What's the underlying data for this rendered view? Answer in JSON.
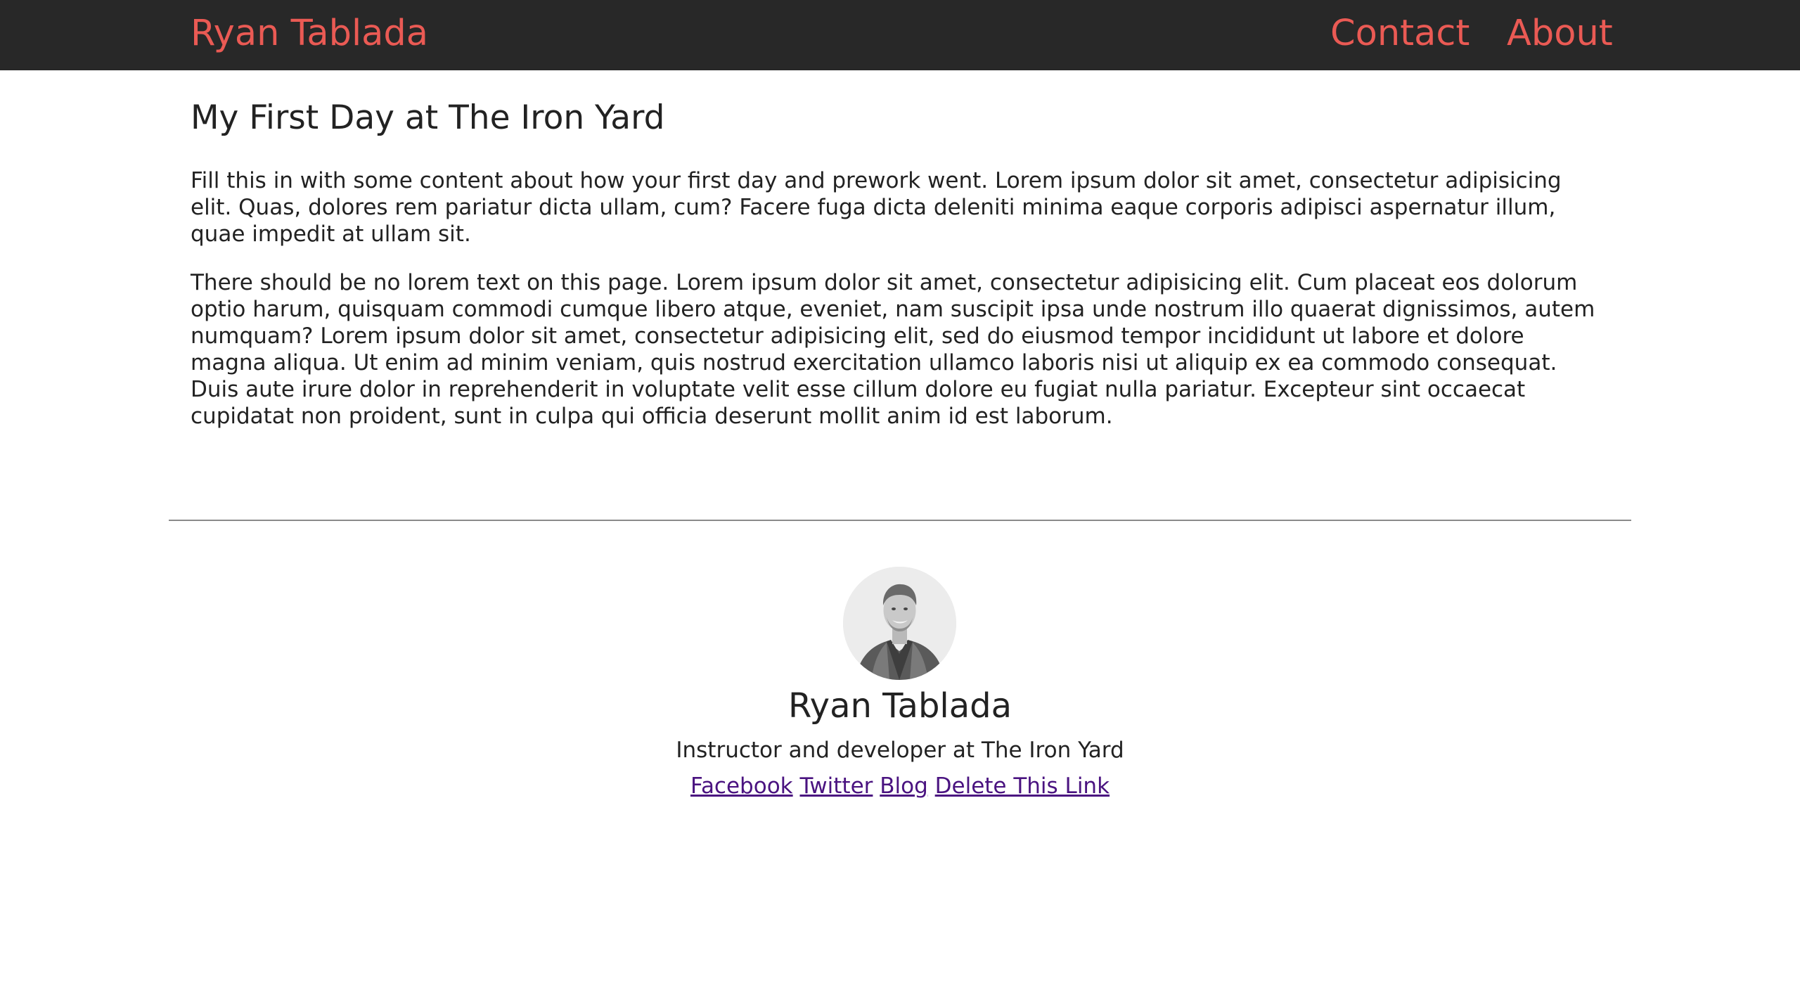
{
  "header": {
    "brand": "Ryan Tablada",
    "nav": [
      {
        "label": "Contact"
      },
      {
        "label": "About"
      }
    ],
    "background_color": "#282828",
    "link_color": "#ea5a54"
  },
  "post": {
    "title": "My First Day at The Iron Yard",
    "paragraphs": [
      "Fill this in with some content about how your first day and prework went. Lorem ipsum dolor sit amet, consectetur adipisicing elit. Quas, dolores rem pariatur dicta ullam, cum? Facere fuga dicta deleniti minima eaque corporis adipisci aspernatur illum, quae impedit at ullam sit.",
      "There should be no lorem text on this page. Lorem ipsum dolor sit amet, consectetur adipisicing elit. Cum placeat eos dolorum optio harum, quisquam commodi cumque libero atque, eveniet, nam suscipit ipsa unde nostrum illo quaerat dignissimos, autem numquam? Lorem ipsum dolor sit amet, consectetur adipisicing elit, sed do eiusmod tempor incididunt ut labore et dolore magna aliqua. Ut enim ad minim veniam, quis nostrud exercitation ullamco laboris nisi ut aliquip ex ea commodo consequat. Duis aute irure dolor in reprehenderit in voluptate velit esse cillum dolore eu fugiat nulla pariatur. Excepteur sint occaecat cupidatat non proident, sunt in culpa qui officia deserunt mollit anim id est laborum."
    ]
  },
  "author": {
    "avatar_icon": "author-avatar-photo",
    "name": "Ryan Tablada",
    "bio": "Instructor and developer at The Iron Yard",
    "links": [
      {
        "label": "Facebook"
      },
      {
        "label": "Twitter"
      },
      {
        "label": "Blog"
      },
      {
        "label": "Delete This Link"
      }
    ],
    "visited_link_color": "#4a1380"
  }
}
